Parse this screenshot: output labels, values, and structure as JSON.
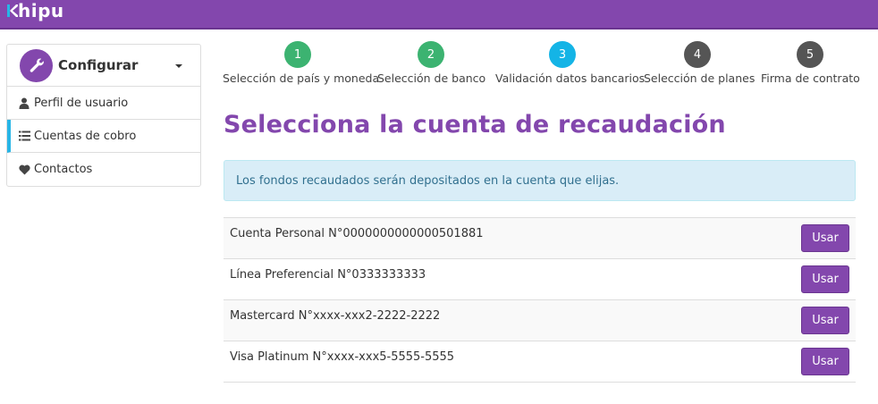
{
  "brand": {
    "logo_text": "hipu"
  },
  "sidebar": {
    "header_label": "Configurar",
    "items": [
      {
        "label": "Perfil de usuario",
        "icon": "user-icon",
        "active": false
      },
      {
        "label": "Cuentas de cobro",
        "icon": "list-icon",
        "active": true
      },
      {
        "label": "Contactos",
        "icon": "heart-icon",
        "active": false
      }
    ]
  },
  "steps": [
    {
      "number": "1",
      "label": "Selección de país y moneda",
      "color": "#3cb371"
    },
    {
      "number": "2",
      "label": "Selección de banco",
      "color": "#3cb371"
    },
    {
      "number": "3",
      "label": "Validación datos bancarios",
      "color": "#14b4e6"
    },
    {
      "number": "4",
      "label": "Selección de planes",
      "color": "#555555"
    },
    {
      "number": "5",
      "label": "Firma de contrato",
      "color": "#555555"
    }
  ],
  "main": {
    "title": "Selecciona la cuenta de recaudación",
    "info": "Los fondos recaudados serán depositados en la cuenta que elijas.",
    "accounts": [
      {
        "name": "Cuenta Personal N°0000000000000501881",
        "button": "Usar"
      },
      {
        "name": "Línea Preferencial N°0333333333",
        "button": "Usar"
      },
      {
        "name": "Mastercard N°xxxx-xxx2-2222-2222",
        "button": "Usar"
      },
      {
        "name": "Visa Platinum N°xxxx-xxx5-5555-5555",
        "button": "Usar"
      }
    ]
  },
  "colors": {
    "brand": "#8347ad",
    "info_bg": "#d9edf7",
    "active_accent": "#27b5e6"
  }
}
